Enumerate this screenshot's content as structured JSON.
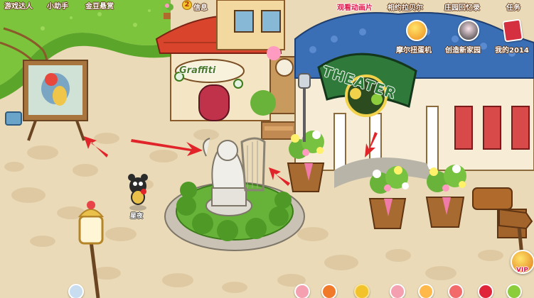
{
  "top_left_menu": [
    {
      "label": "游戏达人",
      "icon": "trophy-icon"
    },
    {
      "label": "小助手",
      "icon": "helper-icon"
    },
    {
      "label": "金豆悬赏",
      "icon": "bounty-icon"
    }
  ],
  "messages": {
    "label": "信息",
    "icon": "message-icon"
  },
  "top_right_menu": [
    {
      "label": "观看动画片",
      "color": "#e0174a"
    },
    {
      "label": "相约拉贝尔",
      "color": "#ffffff"
    },
    {
      "label": "庄园回忆录",
      "color": "#ffffff"
    },
    {
      "label": "任务",
      "color": "#ffffff"
    }
  ],
  "feature_buttons": [
    {
      "label": "摩尔扭蛋机",
      "icon": "gacha-icon"
    },
    {
      "label": "创造新家园",
      "icon": "cat-girl-icon"
    },
    {
      "label": "我的2014",
      "icon": "red-book-icon"
    }
  ],
  "signs": {
    "graffiti": "Graffiti",
    "theater": "THEATER"
  },
  "player": {
    "name": "星夜"
  },
  "vip": {
    "label": "VIP"
  },
  "colors": {
    "grass": "#7cc43c",
    "plaza": "#e9d6b2",
    "theater_roof": "#3a6fb5",
    "graffiti_roof": "#d8452c",
    "red_arrow": "#e0242a"
  }
}
